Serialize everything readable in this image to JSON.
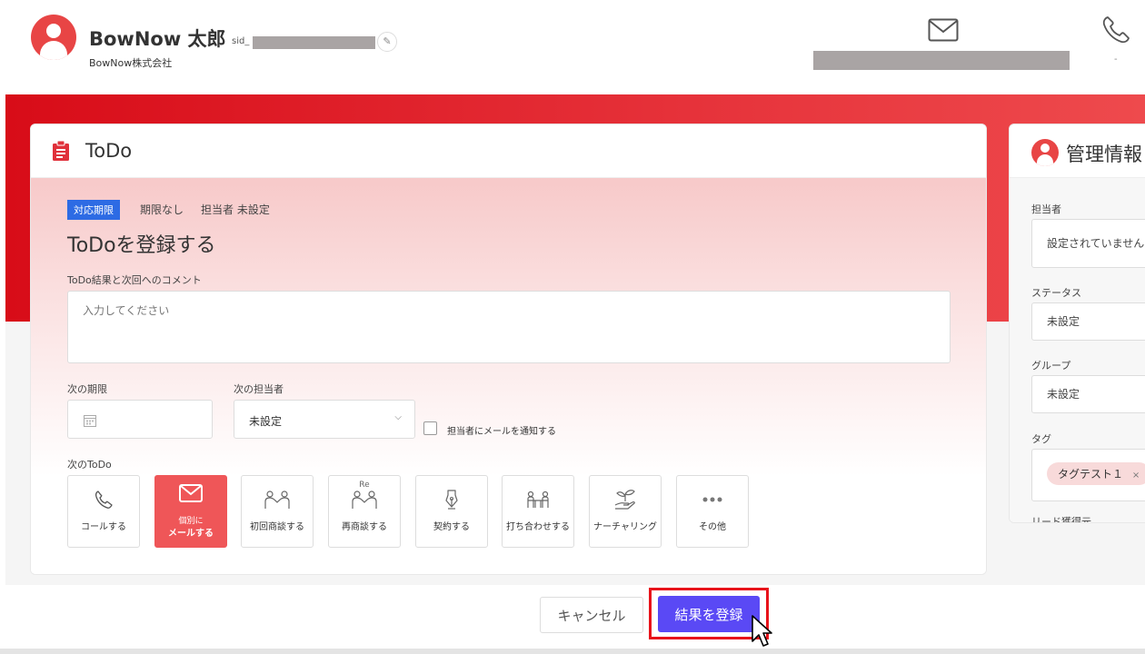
{
  "header": {
    "contact_name": "BowNow 太郎",
    "sid_label": "sid_",
    "company": "BowNow株式会社",
    "phone_value": "-"
  },
  "todo": {
    "title": "ToDo",
    "deadline_badge": "対応期限",
    "deadline_value": "期限なし",
    "assignee_value": "担当者 未設定",
    "register_title": "ToDoを登録する",
    "comment_label": "ToDo結果と次回へのコメント",
    "comment_placeholder": "入力してください",
    "next_deadline_label": "次の期限",
    "next_assignee_label": "次の担当者",
    "next_assignee_value": "未設定",
    "notify_label": "担当者にメールを通知する",
    "next_todo_label": "次のToDo",
    "actions": [
      {
        "label": "コールする",
        "icon": "phone-icon",
        "active": false
      },
      {
        "label_line1": "個別に",
        "label_line2": "メールする",
        "icon": "mail-icon",
        "active": true
      },
      {
        "label": "初回商談する",
        "icon": "meeting-icon",
        "active": false
      },
      {
        "label": "再商談する",
        "icon": "re-meeting-icon",
        "badge": "Re",
        "active": false
      },
      {
        "label": "契約する",
        "icon": "pen-icon",
        "active": false
      },
      {
        "label": "打ち合わせする",
        "icon": "discussion-icon",
        "active": false
      },
      {
        "label": "ナーチャリング",
        "icon": "sprout-icon",
        "active": false
      },
      {
        "label": "その他",
        "icon": "more-icon",
        "active": false
      }
    ]
  },
  "info": {
    "title": "管理情報",
    "assignee_label": "担当者",
    "assignee_value": "設定されていません",
    "status_label": "ステータス",
    "status_value": "未設定",
    "group_label": "グループ",
    "group_value": "未設定",
    "tag_label": "タグ",
    "tag_value": "タグテスト１",
    "tag_remove": "×",
    "lead_label": "リード獲得元"
  },
  "footer": {
    "cancel_label": "キャンセル",
    "submit_label": "結果を登録"
  },
  "colors": {
    "brand_red": "#d80c18",
    "accent_blue": "#2d6be4",
    "submit_purple": "#5a49f5",
    "active_action": "#ef5658"
  }
}
